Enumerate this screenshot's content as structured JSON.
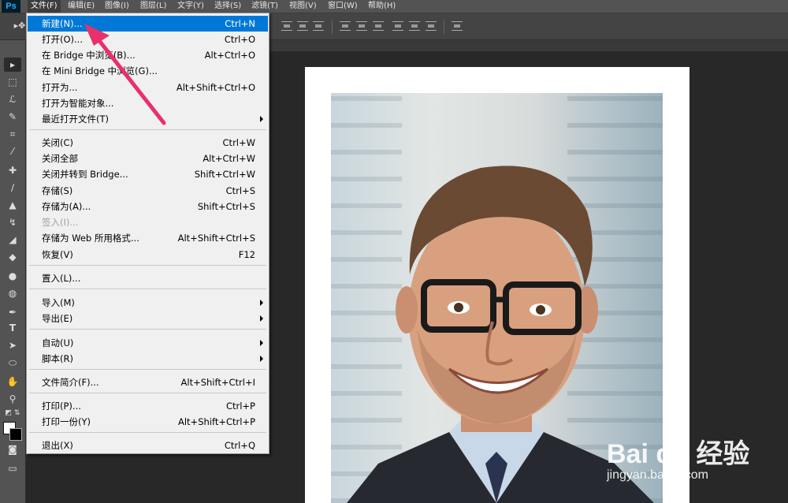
{
  "app": {
    "logo": "Ps"
  },
  "menubar": {
    "items": [
      {
        "label": "文件(F)",
        "active": true
      },
      {
        "label": "编辑(E)"
      },
      {
        "label": "图像(I)"
      },
      {
        "label": "图层(L)"
      },
      {
        "label": "文字(Y)"
      },
      {
        "label": "选择(S)"
      },
      {
        "label": "滤镜(T)"
      },
      {
        "label": "视图(V)"
      },
      {
        "label": "窗口(W)"
      },
      {
        "label": "帮助(H)"
      }
    ]
  },
  "file_menu": {
    "items": [
      {
        "label": "新建(N)...",
        "shortcut": "Ctrl+N",
        "highlighted": true
      },
      {
        "label": "打开(O)...",
        "shortcut": "Ctrl+O"
      },
      {
        "label": "在 Bridge 中浏览(B)...",
        "shortcut": "Alt+Ctrl+O"
      },
      {
        "label": "在 Mini Bridge 中浏览(G)...",
        "shortcut": ""
      },
      {
        "label": "打开为...",
        "shortcut": "Alt+Shift+Ctrl+O"
      },
      {
        "label": "打开为智能对象...",
        "shortcut": ""
      },
      {
        "label": "最近打开文件(T)",
        "shortcut": "",
        "submenu": true
      },
      {
        "label": "关闭(C)",
        "shortcut": "Ctrl+W"
      },
      {
        "label": "关闭全部",
        "shortcut": "Alt+Ctrl+W"
      },
      {
        "label": "关闭并转到 Bridge...",
        "shortcut": "Shift+Ctrl+W"
      },
      {
        "label": "存储(S)",
        "shortcut": "Ctrl+S"
      },
      {
        "label": "存储为(A)...",
        "shortcut": "Shift+Ctrl+S"
      },
      {
        "label": "签入(I)...",
        "shortcut": "",
        "disabled": true
      },
      {
        "label": "存储为 Web 所用格式...",
        "shortcut": "Alt+Shift+Ctrl+S"
      },
      {
        "label": "恢复(V)",
        "shortcut": "F12"
      },
      {
        "label": "置入(L)...",
        "shortcut": ""
      },
      {
        "label": "导入(M)",
        "shortcut": "",
        "submenu": true
      },
      {
        "label": "导出(E)",
        "shortcut": "",
        "submenu": true
      },
      {
        "label": "自动(U)",
        "shortcut": "",
        "submenu": true
      },
      {
        "label": "脚本(R)",
        "shortcut": "",
        "submenu": true
      },
      {
        "label": "文件简介(F)...",
        "shortcut": "Alt+Shift+Ctrl+I"
      },
      {
        "label": "打印(P)...",
        "shortcut": "Ctrl+P"
      },
      {
        "label": "打印一份(Y)",
        "shortcut": "Alt+Shift+Ctrl+P"
      },
      {
        "label": "退出(X)",
        "shortcut": "Ctrl+Q"
      }
    ]
  },
  "tools": {
    "icons": [
      "move-tool-icon",
      "marquee-tool-icon",
      "lasso-tool-icon",
      "quick-selection-tool-icon",
      "crop-tool-icon",
      "eyedropper-tool-icon",
      "healing-brush-tool-icon",
      "brush-tool-icon",
      "clone-stamp-tool-icon",
      "history-brush-tool-icon",
      "eraser-tool-icon",
      "paint-bucket-tool-icon",
      "blur-tool-icon",
      "dodge-tool-icon",
      "pen-tool-icon",
      "type-tool-icon",
      "path-selection-tool-icon",
      "ellipse-tool-icon",
      "hand-tool-icon",
      "zoom-tool-icon"
    ],
    "type_tool_glyph": "T"
  },
  "watermark": {
    "brand": "Bai du 经验",
    "url": "jingyan.baidu.com"
  },
  "colors": {
    "highlight": "#0078d7",
    "annotation_arrow": "#e8306a",
    "menubar": "#535353"
  }
}
